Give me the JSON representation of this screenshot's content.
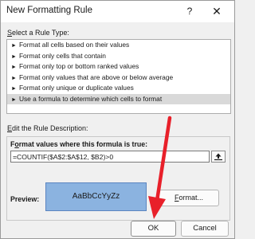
{
  "dialog": {
    "title": "New Formatting Rule",
    "help_icon": "question-mark",
    "close_icon": "close-x"
  },
  "rule_type": {
    "label": "Select a Rule Type:",
    "items": [
      {
        "label": "Format all cells based on their values"
      },
      {
        "label": "Format only cells that contain"
      },
      {
        "label": "Format only top or bottom ranked values"
      },
      {
        "label": "Format only values that are above or below average"
      },
      {
        "label": "Format only unique or duplicate values"
      },
      {
        "label": "Use a formula to determine which cells to format",
        "selected": true
      }
    ],
    "bullet": "►"
  },
  "rule_description": {
    "label": "Edit the Rule Description:",
    "formula_label": "Format values where this formula is true:",
    "formula_value": "=COUNTIF($A$2:$A$12, $B2)>0",
    "preview_label": "Preview:",
    "preview_sample": "AaBbCcYyZz",
    "format_button": "Format..."
  },
  "footer": {
    "ok": "OK",
    "cancel": "Cancel"
  },
  "colors": {
    "annotation_arrow": "#e8202a",
    "preview_fill": "#8bb3e0",
    "selected_row": "#d9d9d9"
  }
}
